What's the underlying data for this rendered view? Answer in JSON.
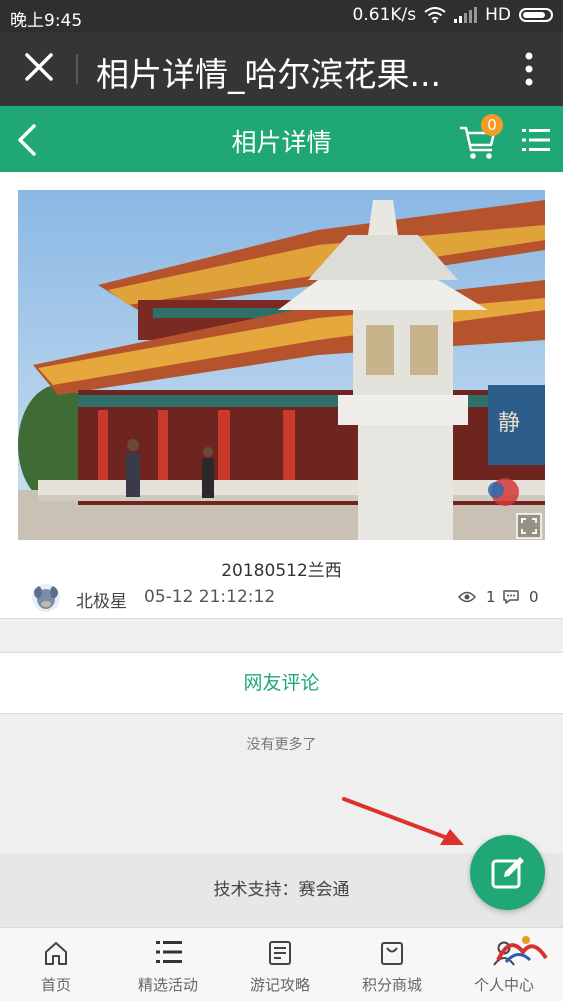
{
  "status_bar": {
    "time": "晚上9:45",
    "network_speed": "0.61K/s",
    "network_type": "HD"
  },
  "browser_bar": {
    "title": "相片详情_哈尔滨花果...",
    "close_icon": "close-icon",
    "more_icon": "more-vertical-icon"
  },
  "header": {
    "title": "相片详情",
    "cart_badge": "0",
    "accent_color": "#1fa876",
    "badge_color": "#f59a23"
  },
  "photo": {
    "caption": "20180512兰西",
    "author": "北极星",
    "datetime": "05-12 21:12:12",
    "views": "1",
    "comments": "0",
    "image_sign_text": "静"
  },
  "comments_section": {
    "label": "网友评论",
    "no_more": "没有更多了"
  },
  "support": {
    "text": "技术支持：赛会通"
  },
  "bottom_nav": {
    "items": [
      {
        "label": "首页",
        "icon": "home-icon"
      },
      {
        "label": "精选活动",
        "icon": "list-icon"
      },
      {
        "label": "游记攻略",
        "icon": "notes-icon"
      },
      {
        "label": "积分商城",
        "icon": "shopping-bag-icon"
      },
      {
        "label": "个人中心",
        "icon": "user-icon"
      }
    ]
  }
}
